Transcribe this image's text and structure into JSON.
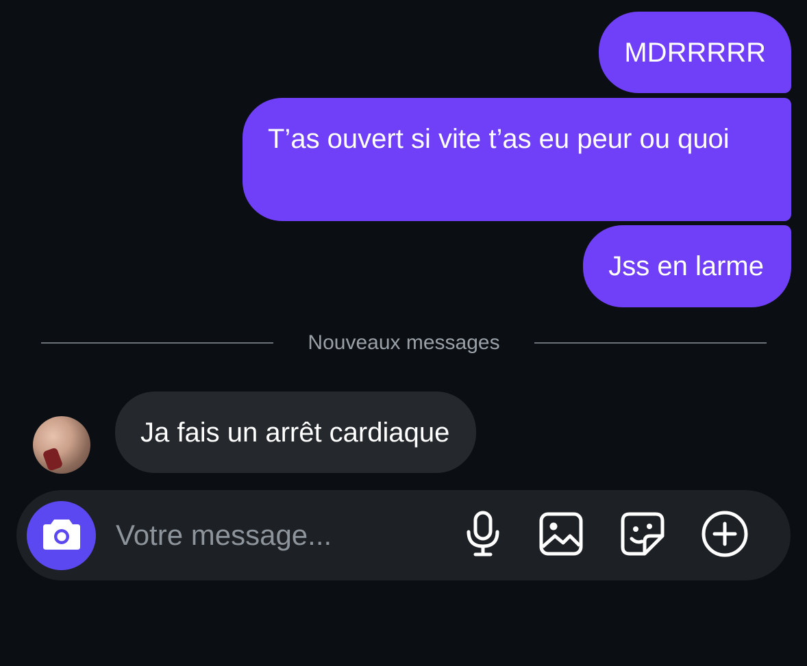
{
  "conversation": {
    "sent_messages": [
      {
        "text": "MDRRRRR"
      },
      {
        "text": "T’as ouvert si vite t’as eu peur ou quoi"
      },
      {
        "text": "Jss en larme"
      }
    ],
    "divider_label": "Nouveaux messages",
    "received_messages": [
      {
        "text": "Ja fais un arrêt cardiaque"
      }
    ]
  },
  "composer": {
    "placeholder": "Votre message...",
    "icons": {
      "camera": "camera-icon",
      "microphone": "microphone-icon",
      "gallery": "image-icon",
      "sticker": "sticker-icon",
      "more": "plus-circle-icon"
    }
  },
  "colors": {
    "background": "#0b0f13",
    "sent_bubble": "#7040f8",
    "received_bubble": "#25292d",
    "camera_button": "#5b48f0",
    "composer": "#1d2024"
  }
}
